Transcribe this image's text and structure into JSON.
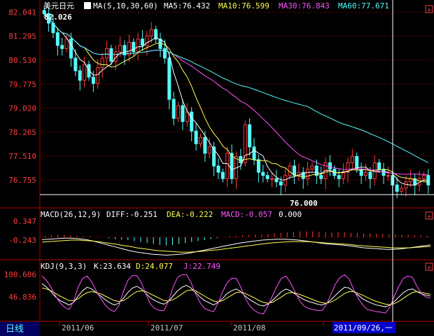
{
  "symbol": "美元日元",
  "period_tab": "日线",
  "cursor_date": "2011/09/26,一",
  "price_panel": {
    "ma_params": "MA(5,10,30,60)",
    "ma5": "MA5:76.432",
    "ma10": "MA10:76.599",
    "ma30": "MA30:76.843",
    "ma60": "MA60:77.671",
    "high_label": "82.026",
    "low_label": "76.000",
    "y_ticks": [
      "82.041",
      "81.295",
      "80.530",
      "79.775",
      "79.020",
      "78.265",
      "77.510",
      "76.755"
    ]
  },
  "macd_panel": {
    "params": "MACD(26,12,9)",
    "diff": "DIFF:-0.251",
    "dea": "DEA:-0.222",
    "macd": "MACD:-0.057",
    "extra": "0.000",
    "y_ticks": [
      "0.347",
      "-0.243"
    ]
  },
  "kdj_panel": {
    "params": "KDJ(9,3,3)",
    "k": "K:23.634",
    "d": "D:24.077",
    "j": "J:22.749",
    "y_ticks": [
      "100.606",
      "46.836"
    ]
  },
  "x_dates": [
    "2011/06",
    "2011/07",
    "2011/08",
    "2011/09"
  ],
  "colors": {
    "up": "#ff3b3b",
    "down": "#54fcfc",
    "ma5": "#ffffff",
    "ma10": "#ffff54",
    "ma30": "#ff54ff",
    "ma60": "#54fcfc",
    "grid": "#b00000",
    "cursor_bg": "#0000cc"
  },
  "chart_data": {
    "type": "candlestick",
    "ylim": [
      75.9,
      82.1
    ],
    "closes": [
      82.0,
      81.7,
      81.4,
      81.0,
      80.9,
      81.2,
      80.6,
      80.2,
      79.9,
      80.4,
      80.0,
      79.8,
      80.3,
      80.6,
      80.9,
      80.5,
      80.8,
      81.0,
      80.7,
      81.1,
      80.8,
      81.2,
      81.0,
      81.3,
      81.5,
      81.2,
      80.9,
      80.6,
      79.3,
      78.7,
      79.1,
      78.6,
      78.9,
      78.3,
      77.9,
      78.1,
      77.6,
      77.8,
      77.2,
      77.0,
      76.8,
      77.6,
      76.8,
      77.5,
      77.3,
      78.5,
      77.8,
      77.4,
      77.0,
      76.9,
      76.8,
      76.8,
      76.7,
      76.6,
      76.9,
      77.2,
      76.9,
      77.0,
      76.8,
      77.1,
      77.2,
      76.9,
      76.8,
      77.3,
      77.1,
      76.9,
      76.8,
      77.0,
      77.3,
      77.5,
      77.1,
      76.9,
      77.0,
      76.8,
      77.3,
      77.1,
      76.9,
      76.9,
      76.6,
      76.4,
      76.5,
      76.7,
      76.8,
      76.6,
      76.8,
      76.9,
      76.6
    ],
    "macd": {
      "macd_hist": [
        0.03,
        0.04,
        0.05,
        0.05,
        0.04,
        0.03,
        0.02,
        0.02,
        0.01,
        0.0,
        -0.02,
        -0.04,
        -0.05,
        -0.06,
        -0.08,
        -0.1,
        -0.12,
        -0.14,
        -0.16,
        -0.17,
        -0.16,
        -0.14,
        -0.12,
        -0.1,
        -0.08,
        -0.06,
        -0.04,
        -0.02,
        0.0,
        0.02,
        0.03,
        0.04,
        0.05,
        0.06,
        0.06,
        0.07,
        0.08,
        0.09,
        0.1,
        0.11,
        0.12,
        0.12,
        0.12,
        0.11,
        0.11,
        0.1,
        0.1,
        0.1,
        0.09,
        0.09,
        0.08,
        0.08,
        0.07,
        0.07,
        0.06,
        0.06,
        0.05,
        0.05,
        0.04,
        0.04,
        0.03
      ],
      "dif": [
        -0.05,
        -0.04,
        -0.03,
        -0.02,
        -0.02,
        -0.03,
        -0.05,
        -0.08,
        -0.12,
        -0.16,
        -0.2,
        -0.24,
        -0.28,
        -0.31,
        -0.33,
        -0.35,
        -0.36,
        -0.37,
        -0.36,
        -0.35,
        -0.33,
        -0.3,
        -0.27,
        -0.24,
        -0.21,
        -0.18,
        -0.15,
        -0.12,
        -0.1,
        -0.08,
        -0.06,
        -0.05,
        -0.04,
        -0.04,
        -0.05,
        -0.06,
        -0.08,
        -0.1,
        -0.12,
        -0.14,
        -0.15,
        -0.16,
        -0.18,
        -0.2,
        -0.22,
        -0.23,
        -0.24,
        -0.25,
        -0.25,
        -0.24,
        -0.22,
        -0.2,
        -0.18,
        -0.16
      ],
      "dea": [
        -0.1,
        -0.09,
        -0.08,
        -0.07,
        -0.06,
        -0.06,
        -0.07,
        -0.08,
        -0.1,
        -0.12,
        -0.14,
        -0.17,
        -0.19,
        -0.22,
        -0.24,
        -0.26,
        -0.28,
        -0.29,
        -0.3,
        -0.31,
        -0.31,
        -0.3,
        -0.29,
        -0.27,
        -0.26,
        -0.24,
        -0.22,
        -0.2,
        -0.18,
        -0.16,
        -0.14,
        -0.12,
        -0.11,
        -0.1,
        -0.09,
        -0.09,
        -0.09,
        -0.1,
        -0.11,
        -0.12,
        -0.13,
        -0.14,
        -0.15,
        -0.17,
        -0.18,
        -0.19,
        -0.2,
        -0.21,
        -0.22,
        -0.22,
        -0.22,
        -0.21,
        -0.2,
        -0.19
      ]
    },
    "kdj": {
      "k": [
        78,
        70,
        60,
        48,
        40,
        35,
        30,
        36,
        50,
        62,
        70,
        66,
        58,
        50,
        42,
        35,
        30,
        34,
        45,
        58,
        68,
        72,
        66,
        56,
        46,
        40,
        35,
        32,
        38,
        50,
        62,
        70,
        74,
        68,
        58,
        48,
        40,
        35,
        30,
        36,
        45,
        56,
        62,
        66,
        60,
        50,
        42,
        36,
        30,
        28,
        32,
        40,
        50,
        60,
        66,
        62,
        55,
        48,
        42,
        38,
        35,
        32,
        30,
        34,
        42,
        52,
        62,
        70,
        68,
        60,
        52,
        44,
        38,
        34,
        30,
        28,
        26,
        30,
        38,
        48,
        58,
        64,
        66,
        60,
        55,
        52,
        50
      ],
      "d": [
        68,
        66,
        62,
        56,
        50,
        45,
        40,
        40,
        44,
        52,
        58,
        60,
        58,
        55,
        50,
        45,
        40,
        38,
        40,
        46,
        54,
        60,
        62,
        60,
        55,
        50,
        45,
        40,
        39,
        42,
        48,
        55,
        62,
        64,
        62,
        56,
        50,
        44,
        39,
        37,
        40,
        46,
        52,
        58,
        59,
        56,
        51,
        46,
        40,
        36,
        34,
        36,
        42,
        48,
        55,
        58,
        57,
        54,
        50,
        46,
        42,
        38,
        35,
        34,
        37,
        42,
        49,
        56,
        60,
        60,
        56,
        52,
        47,
        42,
        38,
        35,
        32,
        31,
        33,
        38,
        45,
        52,
        58,
        60,
        58,
        56,
        54
      ],
      "j": [
        95,
        85,
        70,
        50,
        35,
        25,
        20,
        38,
        70,
        90,
        95,
        82,
        62,
        45,
        30,
        20,
        15,
        28,
        60,
        85,
        96,
        96,
        80,
        55,
        32,
        22,
        18,
        18,
        38,
        70,
        92,
        98,
        98,
        80,
        55,
        35,
        22,
        18,
        15,
        35,
        60,
        80,
        90,
        90,
        70,
        45,
        28,
        18,
        12,
        10,
        28,
        50,
        72,
        90,
        95,
        80,
        60,
        40,
        28,
        22,
        20,
        18,
        18,
        32,
        55,
        78,
        92,
        98,
        88,
        65,
        45,
        30,
        20,
        18,
        15,
        14,
        12,
        25,
        50,
        72,
        90,
        95,
        92,
        72,
        55,
        48,
        45
      ]
    }
  }
}
